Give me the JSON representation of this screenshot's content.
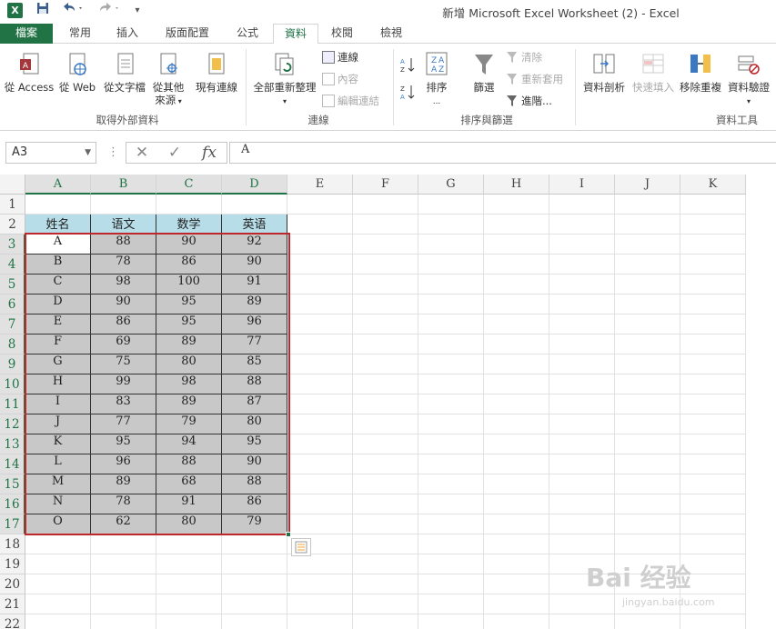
{
  "window": {
    "title": "新增 Microsoft Excel Worksheet (2) - Excel",
    "app_icon": "X"
  },
  "tabs": [
    {
      "label": "檔案"
    },
    {
      "label": "常用"
    },
    {
      "label": "插入"
    },
    {
      "label": "版面配置"
    },
    {
      "label": "公式"
    },
    {
      "label": "資料"
    },
    {
      "label": "校閱"
    },
    {
      "label": "檢視"
    }
  ],
  "ribbon": {
    "external": {
      "access": "從 Access",
      "web": "從 Web",
      "text": "從文字檔",
      "other_1": "從其他",
      "other_2": "來源",
      "existing": "現有連線",
      "group": "取得外部資料"
    },
    "connections": {
      "refresh_all": "全部重新整理",
      "connections": "連線",
      "properties": "內容",
      "edit_links": "編輯連結",
      "group": "連線"
    },
    "sort_filter": {
      "sort": "排序",
      "filter": "篩選",
      "clear": "清除",
      "reapply": "重新套用",
      "advanced": "進階...",
      "group": "排序與篩選"
    },
    "tools": {
      "text_to_columns": "資料剖析",
      "flash_fill": "快速填入",
      "remove_duplicates": "移除重複",
      "validation": "資料驗證",
      "group": "資料工具"
    }
  },
  "formula_bar": {
    "name_box": "A3",
    "formula": "A"
  },
  "columns": [
    "A",
    "B",
    "C",
    "D",
    "E",
    "F",
    "G",
    "H",
    "I",
    "J",
    "K"
  ],
  "rows": [
    "1",
    "2",
    "3",
    "4",
    "5",
    "6",
    "7",
    "8",
    "9",
    "10",
    "11",
    "12",
    "13",
    "14",
    "15",
    "16",
    "17",
    "18",
    "19",
    "20",
    "21",
    "22"
  ],
  "table": {
    "headers": [
      "姓名",
      "语文",
      "数学",
      "英语"
    ],
    "rows": [
      [
        "A",
        "88",
        "90",
        "92"
      ],
      [
        "B",
        "78",
        "86",
        "90"
      ],
      [
        "C",
        "98",
        "100",
        "91"
      ],
      [
        "D",
        "90",
        "95",
        "89"
      ],
      [
        "E",
        "86",
        "95",
        "96"
      ],
      [
        "F",
        "69",
        "89",
        "77"
      ],
      [
        "G",
        "75",
        "80",
        "85"
      ],
      [
        "H",
        "99",
        "98",
        "88"
      ],
      [
        "I",
        "83",
        "89",
        "87"
      ],
      [
        "J",
        "77",
        "79",
        "80"
      ],
      [
        "K",
        "95",
        "94",
        "95"
      ],
      [
        "L",
        "96",
        "88",
        "90"
      ],
      [
        "M",
        "89",
        "68",
        "88"
      ],
      [
        "N",
        "78",
        "91",
        "86"
      ],
      [
        "O",
        "62",
        "80",
        "79"
      ]
    ]
  },
  "watermark": {
    "text": "Bai 经验",
    "sub": "jingyan.baidu.com"
  }
}
